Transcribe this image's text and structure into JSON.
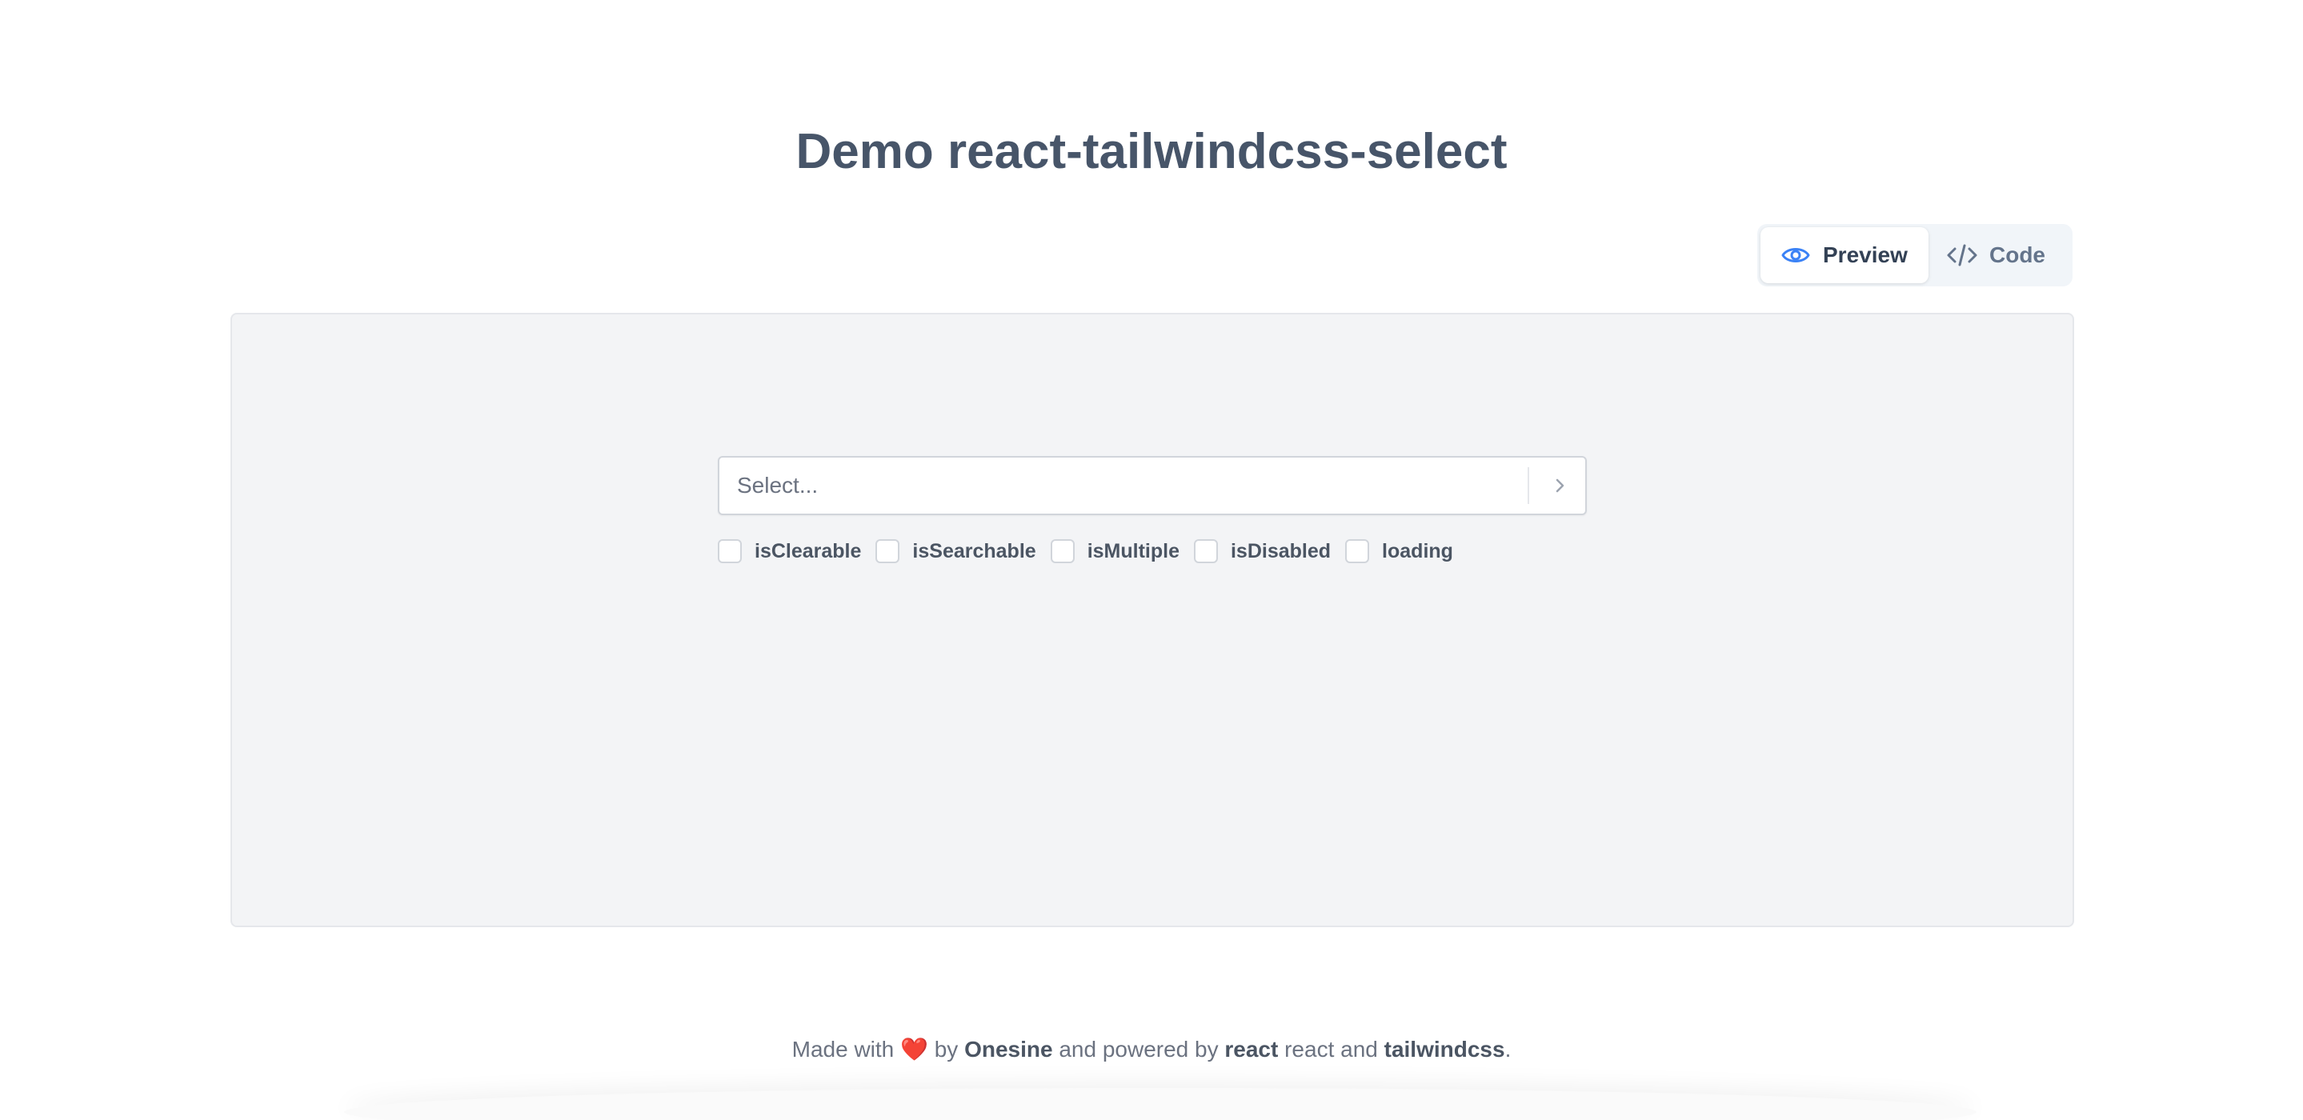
{
  "page": {
    "title": "Demo react-tailwindcss-select"
  },
  "view_toggle": {
    "preview_label": "Preview",
    "preview_icon": "eye-icon",
    "code_label": "Code",
    "code_icon": "code-icon",
    "active": "Preview"
  },
  "select": {
    "placeholder": "Select...",
    "chevron_icon": "chevron-right-icon"
  },
  "options": [
    {
      "label": "isClearable",
      "checked": false
    },
    {
      "label": "isSearchable",
      "checked": false
    },
    {
      "label": "isMultiple",
      "checked": false
    },
    {
      "label": "isDisabled",
      "checked": false
    },
    {
      "label": "loading",
      "checked": false
    }
  ],
  "footer": {
    "made_with": "Made with",
    "heart": "❤️",
    "by": "by",
    "author": "Onesine",
    "powered_by": "and powered by",
    "react_link": "react",
    "react_text": "react",
    "and": "and",
    "tailwind_link": "tailwindcss",
    "period": "."
  },
  "colors": {
    "accent": "#3b82f6",
    "title": "#475569",
    "panel_bg": "#f3f4f6"
  }
}
